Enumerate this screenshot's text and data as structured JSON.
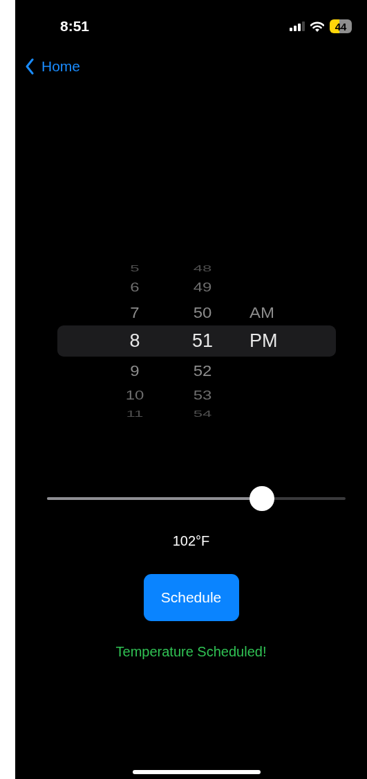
{
  "status_bar": {
    "time": "8:51",
    "battery": "44"
  },
  "nav": {
    "back_label": "Home"
  },
  "picker": {
    "columns": [
      {
        "items": [
          {
            "label": "5",
            "selected": false
          },
          {
            "label": "6",
            "selected": false
          },
          {
            "label": "7",
            "selected": false
          },
          {
            "label": "8",
            "selected": true
          },
          {
            "label": "9",
            "selected": false
          },
          {
            "label": "10",
            "selected": false
          },
          {
            "label": "11",
            "selected": false
          }
        ]
      },
      {
        "items": [
          {
            "label": "48",
            "selected": false
          },
          {
            "label": "49",
            "selected": false
          },
          {
            "label": "50",
            "selected": false
          },
          {
            "label": "51",
            "selected": true
          },
          {
            "label": "52",
            "selected": false
          },
          {
            "label": "53",
            "selected": false
          },
          {
            "label": "54",
            "selected": false
          }
        ]
      },
      {
        "items": [
          {
            "label": "AM",
            "selected": false
          },
          {
            "label": "PM",
            "selected": true
          }
        ]
      }
    ]
  },
  "slider": {
    "level": 0.72
  },
  "temperature": "102°F",
  "button": "Schedule",
  "message": "Temperature Scheduled!"
}
